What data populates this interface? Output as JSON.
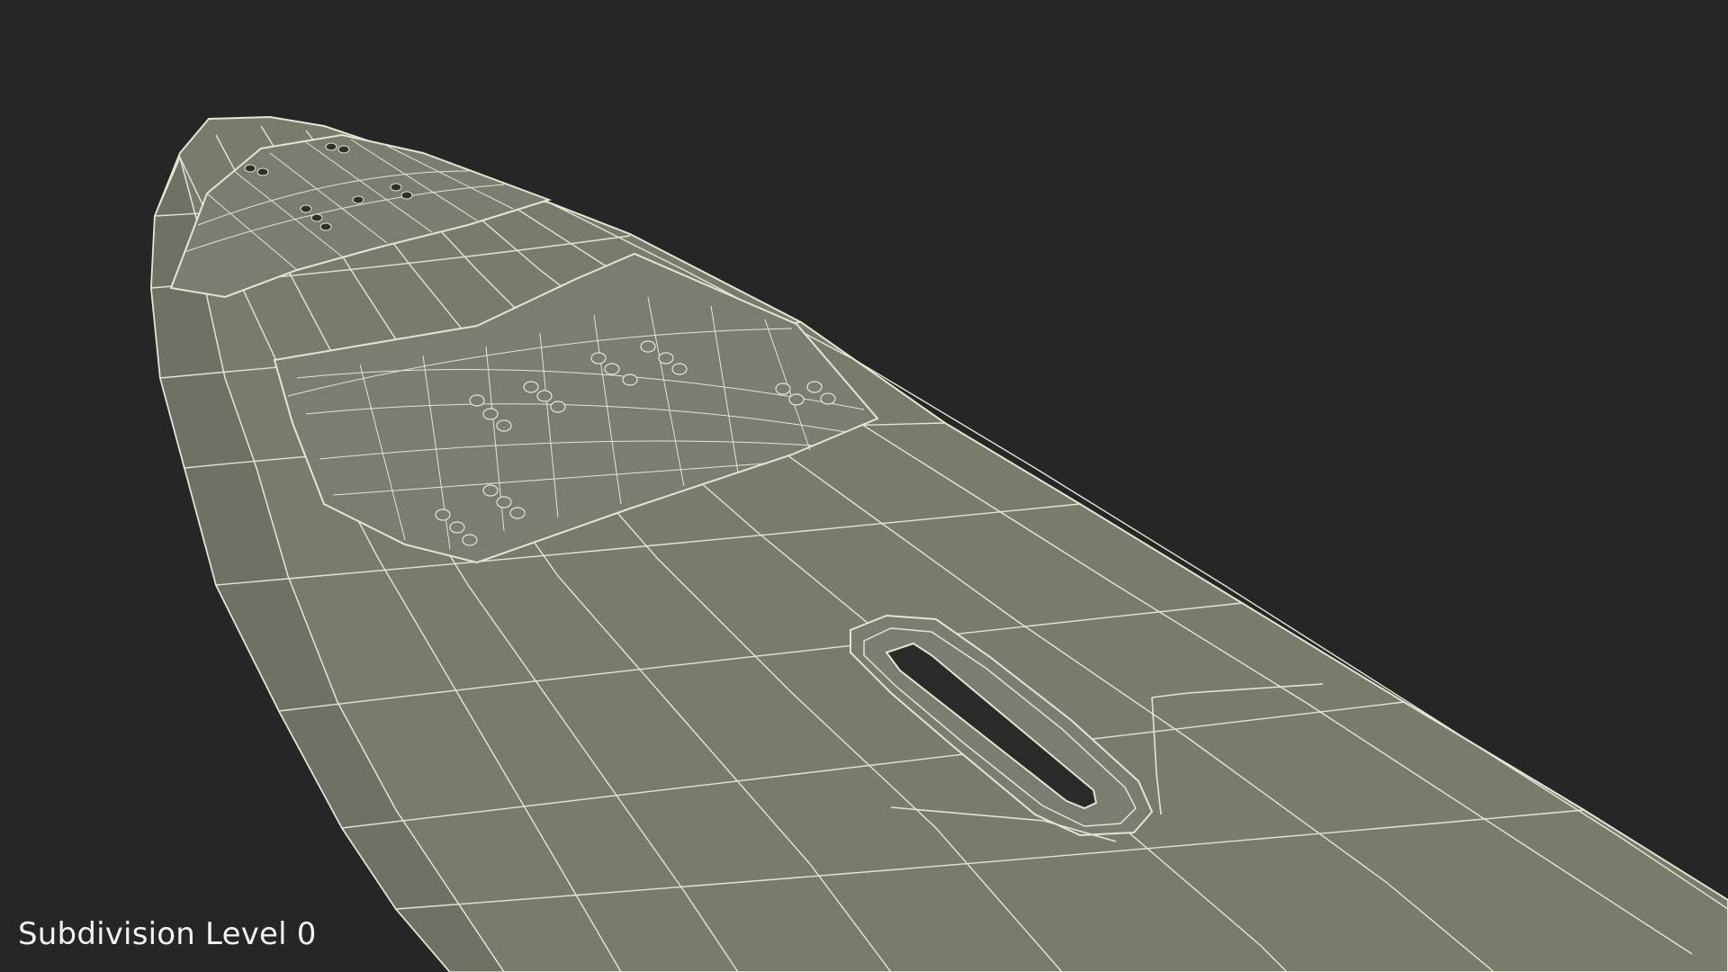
{
  "render": {
    "caption": "Subdivision Level 0"
  },
  "colors": {
    "background": "#262626",
    "surface": "#797b6d",
    "surface_shade": "#6f7165",
    "wire": "#e4e6d2",
    "slot": "#2a2a28"
  }
}
